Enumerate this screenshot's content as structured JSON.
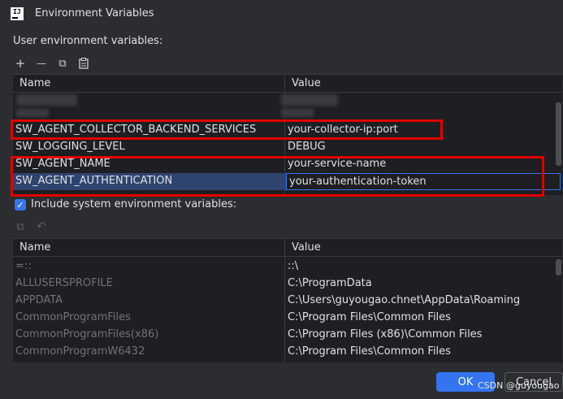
{
  "dialog": {
    "title": "Environment Variables"
  },
  "user_section": {
    "label": "User environment variables:",
    "toolbar": {
      "add": "+",
      "remove": "—",
      "copy": "⧉",
      "paste": "📋"
    },
    "headers": {
      "name": "Name",
      "value": "Value"
    },
    "rows": [
      {
        "name": "SW_AGENT_COLLECTOR_BACKEND_SERVICES",
        "value": "your-collector-ip:port"
      },
      {
        "name": "SW_LOGGING_LEVEL",
        "value": "DEBUG"
      },
      {
        "name": "SW_AGENT_NAME",
        "value": "your-service-name"
      },
      {
        "name": "SW_AGENT_AUTHENTICATION",
        "value": "your-authentication-token"
      }
    ]
  },
  "include_system": {
    "label": "Include system environment variables:",
    "checked": true
  },
  "system_section": {
    "headers": {
      "name": "Name",
      "value": "Value"
    },
    "rows": [
      {
        "name": "=::",
        "value": "::\\"
      },
      {
        "name": "ALLUSERSPROFILE",
        "value": "C:\\ProgramData"
      },
      {
        "name": "APPDATA",
        "value": "C:\\Users\\guyougao.chnet\\AppData\\Roaming"
      },
      {
        "name": "CommonProgramFiles",
        "value": "C:\\Program Files\\Common Files"
      },
      {
        "name": "CommonProgramFiles(x86)",
        "value": "C:\\Program Files (x86)\\Common Files"
      },
      {
        "name": "CommonProgramW6432",
        "value": "C:\\Program Files\\Common Files"
      }
    ]
  },
  "buttons": {
    "ok": "OK",
    "cancel": "Cancel"
  },
  "watermark": "CSDN @guyougao",
  "colors": {
    "accent": "#3574f0",
    "highlight_box": "#e00000",
    "selection": "#2e436e"
  }
}
